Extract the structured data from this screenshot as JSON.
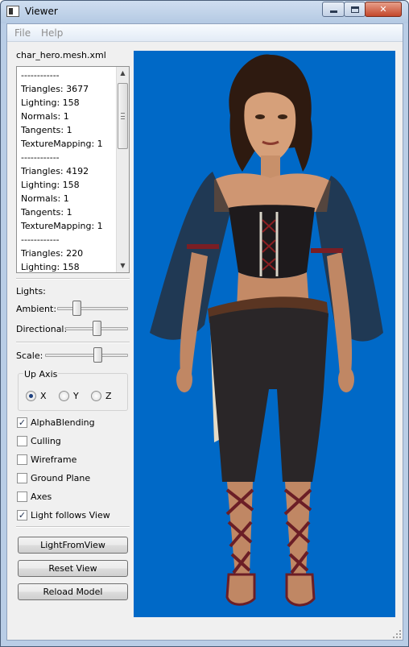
{
  "window": {
    "title": "Viewer",
    "icon": "viewer-app-icon",
    "controls": [
      "minimize",
      "maximize",
      "close"
    ]
  },
  "menu": {
    "items": [
      "File",
      "Help"
    ]
  },
  "sidebar": {
    "mesh_file": "char_hero.mesh.xml",
    "info_lines": [
      "------------",
      "Triangles: 3677",
      "Lighting: 158",
      "Normals: 1",
      "Tangents: 1",
      "TextureMapping: 1",
      "------------",
      "Triangles: 4192",
      "Lighting: 158",
      "Normals: 1",
      "Tangents: 1",
      "TextureMapping: 1",
      "------------",
      "Triangles: 220",
      "Lighting: 158"
    ],
    "lights_label": "Lights:",
    "ambient_label": "Ambient:",
    "ambient_value": 0.25,
    "directional_label": "Directional:",
    "directional_value": 0.5,
    "scale_label": "Scale:",
    "scale_value": 0.65,
    "up_axis": {
      "title": "Up Axis",
      "options": [
        "X",
        "Y",
        "Z"
      ],
      "selected": "X"
    },
    "options": [
      {
        "label": "AlphaBlending",
        "checked": true
      },
      {
        "label": "Culling",
        "checked": false
      },
      {
        "label": "Wireframe",
        "checked": false
      },
      {
        "label": "Ground Plane",
        "checked": false
      },
      {
        "label": "Axes",
        "checked": false
      },
      {
        "label": "Light follows View",
        "checked": true
      }
    ],
    "buttons": {
      "light_from_view": "LightFromView",
      "reset_view": "Reset View",
      "reload_model": "Reload Model"
    }
  },
  "viewport": {
    "background_color": "#0069c7",
    "subject": "3d-character-model"
  }
}
